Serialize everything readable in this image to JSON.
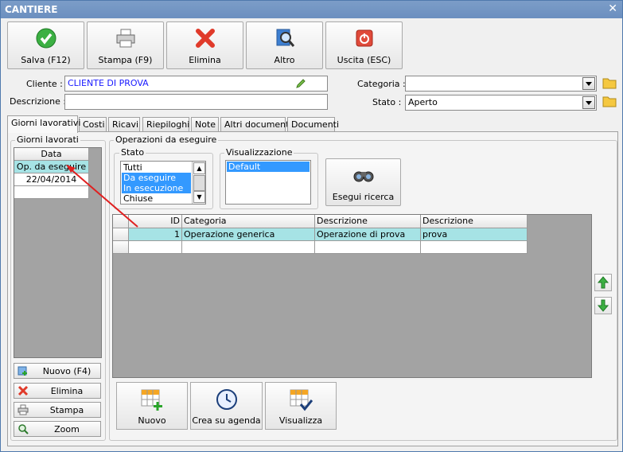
{
  "window": {
    "title": "CANTIERE",
    "close": "✕"
  },
  "toolbar": [
    {
      "label": "Salva (F12)",
      "icon": "check-icon"
    },
    {
      "label": "Stampa (F9)",
      "icon": "printer-icon"
    },
    {
      "label": "Elimina",
      "icon": "delete-icon"
    },
    {
      "label": "Altro",
      "icon": "search-icon"
    },
    {
      "label": "Uscita (ESC)",
      "icon": "power-icon"
    }
  ],
  "form": {
    "cliente_label": "Cliente :",
    "cliente_value": "CLIENTE DI PROVA",
    "descrizione_label": "Descrizione :",
    "descrizione_value": "",
    "categoria_label": "Categoria :",
    "categoria_value": "",
    "stato_label": "Stato :",
    "stato_value": "Aperto"
  },
  "tabs": [
    "Giorni lavorativi",
    "Costi",
    "Ricavi",
    "Riepiloghi",
    "Note",
    "Altri documenti",
    "Documenti"
  ],
  "giorni": {
    "group_title": "Giorni lavorati",
    "header": "Data",
    "rows": [
      "Op. da eseguire",
      "22/04/2014"
    ],
    "buttons": [
      "Nuovo (F4)",
      "Elimina",
      "Stampa",
      "Zoom"
    ]
  },
  "operazioni": {
    "group_title": "Operazioni da eseguire",
    "stato_title": "Stato",
    "stato_items": [
      "Tutti",
      "Da eseguire",
      "In esecuzione",
      "Chiuse"
    ],
    "vis_title": "Visualizzazione",
    "vis_items": [
      "Default"
    ],
    "search_button": "Esegui ricerca",
    "columns": [
      "ID",
      "Categoria",
      "Descrizione",
      "Descrizione"
    ],
    "rows": [
      [
        "1",
        "Operazione generica",
        "Operazione di prova",
        "prova"
      ]
    ],
    "bottom_buttons": [
      "Nuovo",
      "Crea su agenda",
      "Visualizza"
    ]
  },
  "colors": {
    "title_bar": "#6b8fbf",
    "selection": "#a6e3e5",
    "list_selection": "#3399ff",
    "grid_bg": "#a3a3a3",
    "annotation_arrow": "#e02020"
  }
}
